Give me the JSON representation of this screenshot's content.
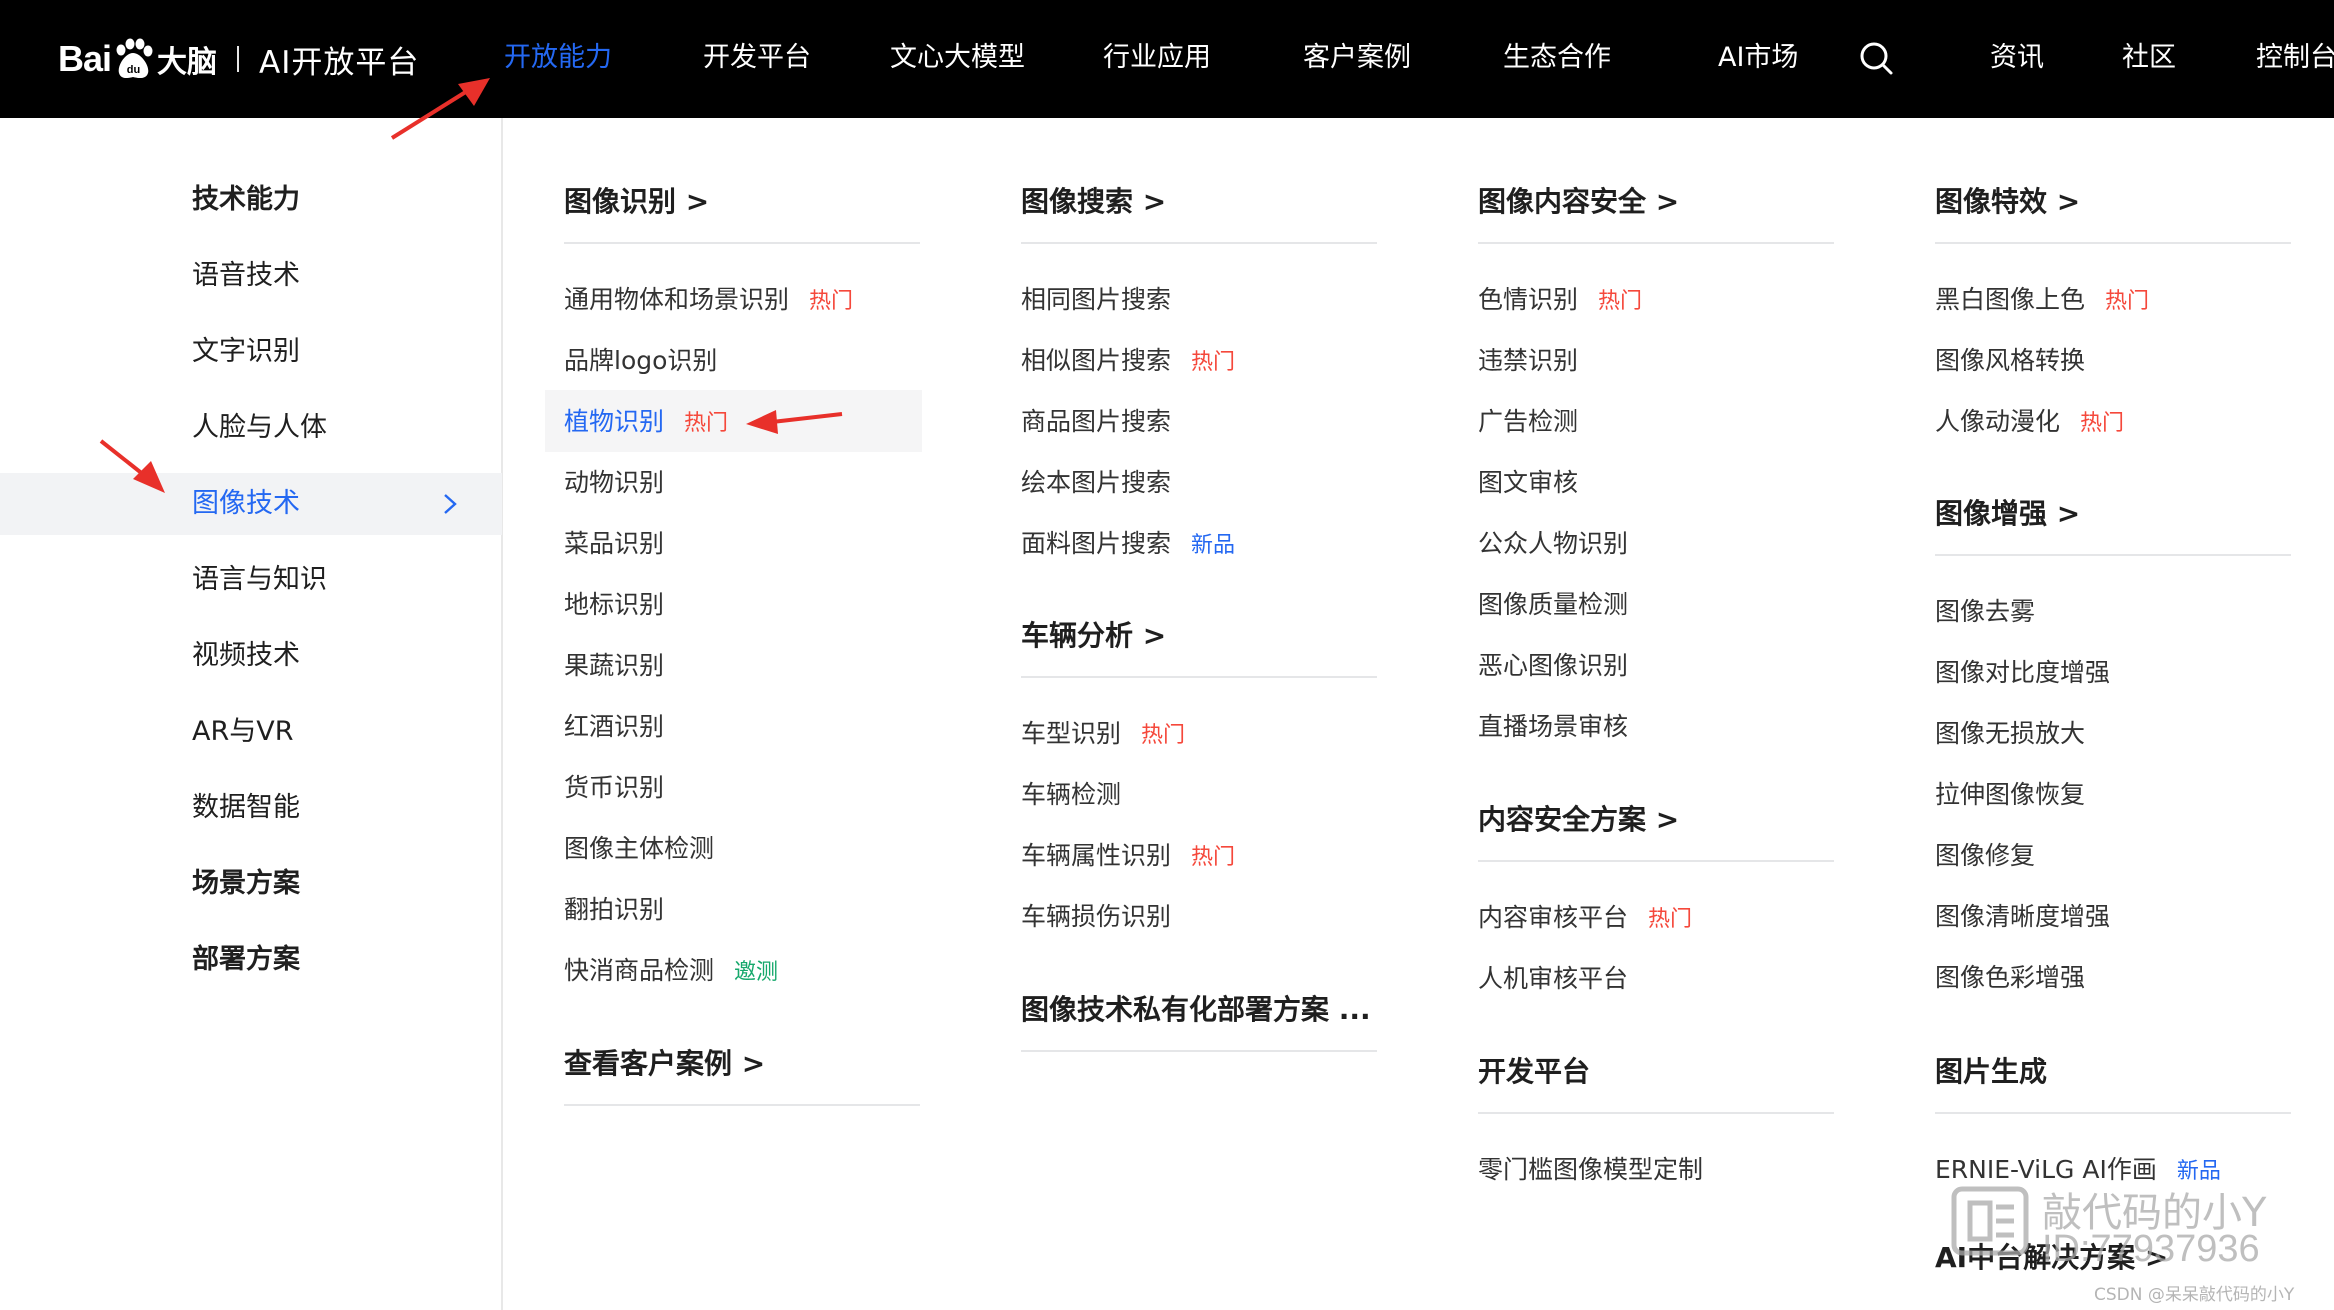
{
  "brand": {
    "logo_bai": "Bai",
    "logo_du": "du",
    "logo_danao": "大脑",
    "platform": "AI开放平台"
  },
  "nav": [
    {
      "label": "开放能力",
      "active": true
    },
    {
      "label": "开发平台"
    },
    {
      "label": "文心大模型"
    },
    {
      "label": "行业应用"
    },
    {
      "label": "客户案例"
    },
    {
      "label": "生态合作"
    },
    {
      "label": "AI市场"
    },
    {
      "label": "资讯"
    },
    {
      "label": "社区"
    },
    {
      "label": "控制台"
    }
  ],
  "categories": [
    {
      "label": "技术能力",
      "bold": true
    },
    {
      "label": "语音技术"
    },
    {
      "label": "文字识别"
    },
    {
      "label": "人脸与人体"
    },
    {
      "label": "图像技术",
      "selected": true
    },
    {
      "label": "语言与知识"
    },
    {
      "label": "视频技术"
    },
    {
      "label": "AR与VR"
    },
    {
      "label": "数据智能"
    },
    {
      "label": "场景方案",
      "bold": true
    },
    {
      "label": "部署方案",
      "bold": true
    }
  ],
  "columns": {
    "col1": {
      "title": "图像识别 >",
      "items": [
        {
          "label": "通用物体和场景识别",
          "tag": "热门"
        },
        {
          "label": "品牌logo识别"
        },
        {
          "label": "植物识别",
          "tag": "热门"
        },
        {
          "label": "动物识别"
        },
        {
          "label": "菜品识别"
        },
        {
          "label": "地标识别"
        },
        {
          "label": "果蔬识别"
        },
        {
          "label": "红酒识别"
        },
        {
          "label": "货币识别"
        },
        {
          "label": "图像主体检测"
        },
        {
          "label": "翻拍识别"
        },
        {
          "label": "快消商品检测",
          "tag": "邀测"
        }
      ],
      "footer": "查看客户案例 >"
    },
    "col2": {
      "title": "图像搜索 >",
      "items": [
        {
          "label": "相同图片搜索"
        },
        {
          "label": "相似图片搜索",
          "tag": "热门"
        },
        {
          "label": "商品图片搜索"
        },
        {
          "label": "绘本图片搜索"
        },
        {
          "label": "面料图片搜索",
          "tag": "新品"
        }
      ],
      "title2": "车辆分析 >",
      "items2": [
        {
          "label": "车型识别",
          "tag": "热门"
        },
        {
          "label": "车辆检测"
        },
        {
          "label": "车辆属性识别",
          "tag": "热门"
        },
        {
          "label": "车辆损伤识别"
        }
      ],
      "footer": "图像技术私有化部署方案 ..."
    },
    "col3": {
      "title": "图像内容安全 >",
      "items": [
        {
          "label": "色情识别",
          "tag": "热门"
        },
        {
          "label": "违禁识别"
        },
        {
          "label": "广告检测"
        },
        {
          "label": "图文审核"
        },
        {
          "label": "公众人物识别"
        },
        {
          "label": "图像质量检测"
        },
        {
          "label": "恶心图像识别"
        },
        {
          "label": "直播场景审核"
        }
      ],
      "title2": "内容安全方案 >",
      "items2": [
        {
          "label": "内容审核平台",
          "tag": "热门"
        },
        {
          "label": "人机审核平台"
        }
      ],
      "title3": "开发平台",
      "items3": [
        {
          "label": "零门槛图像模型定制"
        }
      ]
    },
    "col4": {
      "title": "图像特效 >",
      "items": [
        {
          "label": "黑白图像上色",
          "tag": "热门"
        },
        {
          "label": "图像风格转换"
        },
        {
          "label": "人像动漫化",
          "tag": "热门"
        }
      ],
      "title2": "图像增强 >",
      "items2": [
        {
          "label": "图像去雾"
        },
        {
          "label": "图像对比度增强"
        },
        {
          "label": "图像无损放大"
        },
        {
          "label": "拉伸图像恢复"
        },
        {
          "label": "图像修复"
        },
        {
          "label": "图像清晰度增强"
        },
        {
          "label": "图像色彩增强"
        }
      ],
      "title3": "图片生成",
      "items3": [
        {
          "label": "ERNIE-ViLG AI作画",
          "tag": "新品"
        }
      ],
      "title4": "AI中台解决方案 >"
    }
  },
  "watermark": {
    "line1": "敲代码的小Y",
    "line2": "ID:77937936",
    "credit": "CSDN @呆呆敲代码的小Y"
  },
  "colors": {
    "topbar": "#000000",
    "accent": "#2468f2",
    "hot": "#f5483b",
    "beta": "#15a86b",
    "arrow": "#e8302a"
  }
}
